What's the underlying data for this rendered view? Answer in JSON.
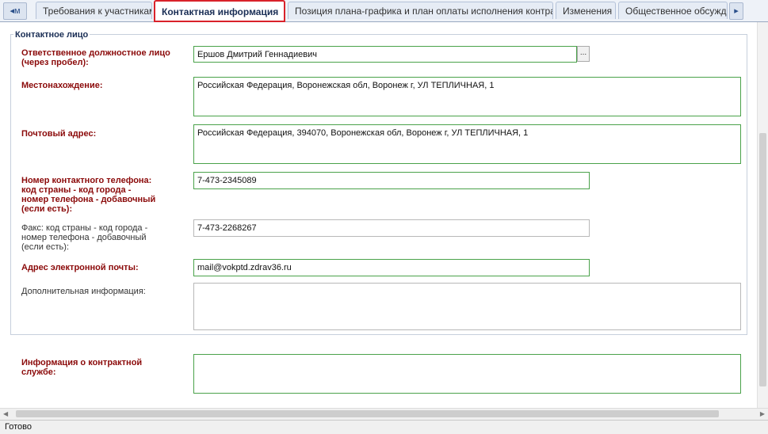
{
  "tabs": {
    "partial_left": "м",
    "items": [
      {
        "label": "Требования к участникам"
      },
      {
        "label": "Контактная информация"
      },
      {
        "label": "Позиция плана-графика и план оплаты исполнения контракта"
      },
      {
        "label": "Изменения"
      },
      {
        "label": "Общественное обсуждение"
      }
    ],
    "active_index": 1
  },
  "group": {
    "legend": "Контактное лицо"
  },
  "fields": {
    "responsible": {
      "label_line1": "Ответственное должностное лицо",
      "label_line2": "(через пробел):",
      "value": "Ершов Дмитрий Геннадиевич",
      "lookup_label": "..."
    },
    "location": {
      "label": "Местонахождение:",
      "value": "Российская Федерация, Воронежская обл, Воронеж г, УЛ ТЕПЛИЧНАЯ, 1"
    },
    "postal": {
      "label": "Почтовый адрес:",
      "value": "Российская Федерация, 394070, Воронежская обл, Воронеж г, УЛ ТЕПЛИЧНАЯ, 1"
    },
    "phone": {
      "label_line1": "Номер контактного телефона:",
      "label_line2": "код страны - код города -",
      "label_line3": "номер телефона - добавочный",
      "label_line4": "(если есть):",
      "value": "7-473-2345089"
    },
    "fax": {
      "label_line1": "Факс: код страны - код города -",
      "label_line2": "номер телефона - добавочный",
      "label_line3": "(если есть):",
      "value": "7-473-2268267"
    },
    "email": {
      "label": "Адрес электронной почты:",
      "value": "mail@vokptd.zdrav36.ru"
    },
    "additional": {
      "label": "Дополнительная информация:",
      "value": ""
    },
    "contract_service": {
      "label_line1": "Информация о контрактной",
      "label_line2": "службе:",
      "value": ""
    }
  },
  "status": {
    "text": "Готово"
  },
  "colors": {
    "active_tab_border": "#d9222a",
    "required_label": "#8b0a0a",
    "valid_field_border": "#4aa24a"
  },
  "icons": {
    "scroll_left": "arrow-left-icon",
    "scroll_right": "arrow-right-icon"
  }
}
